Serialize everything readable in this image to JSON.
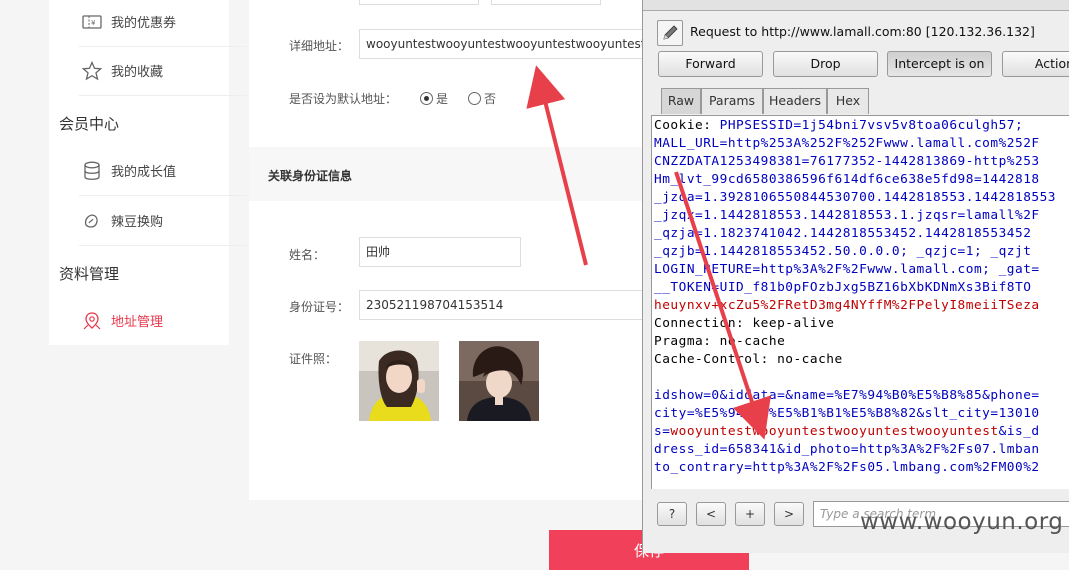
{
  "sidebar": {
    "items": [
      {
        "label": "我的优惠券",
        "icon": "coupon-icon"
      },
      {
        "label": "我的收藏",
        "icon": "star-icon"
      },
      {
        "label": "我的成长值",
        "icon": "database-icon"
      },
      {
        "label": "辣豆换购",
        "icon": "bean-icon"
      },
      {
        "label": "地址管理",
        "icon": "location-pin-icon"
      }
    ],
    "heads": [
      "会员中心",
      "资料管理"
    ]
  },
  "form": {
    "address_label": "详细地址：",
    "address_value": "wooyuntestwooyuntestwooyuntestwooyuntest",
    "default_label": "是否设为默认地址：",
    "yes": "是",
    "no": "否",
    "section_title": "关联身份证信息",
    "name_label": "姓名：",
    "name_value": "田帅",
    "id_label": "身份证号：",
    "id_value": "230521198704153514",
    "photo_label": "证件照：",
    "save": "保存"
  },
  "burp": {
    "request": "Request to http://www.lamall.com:80  [120.132.36.132]",
    "buttons": [
      "Forward",
      "Drop",
      "Intercept is on",
      "Action"
    ],
    "tabs": [
      "Raw",
      "Params",
      "Headers",
      "Hex"
    ],
    "lines": [
      {
        "k": "Cookie: ",
        "v": "PHPSESSID=1j54bni7vsv5v8toa06culgh57;"
      },
      {
        "k": "",
        "v": "MALL_URL=http%253A%252F%252Fwww.lamall.com%252F"
      },
      {
        "k": "",
        "v": "CNZZDATA1253498381=76177352-1442813869-http%253"
      },
      {
        "k": "",
        "v": "Hm_lvt_99cd6580386596f614df6ce638e5fd98=1442818"
      },
      {
        "k": "",
        "v": "_jzqa=1.3928106550844530700.1442818553.1442818553"
      },
      {
        "k": "",
        "v": "_jzqx=1.1442818553.1442818553.1.jzqsr=lamall%2F"
      },
      {
        "k": "",
        "v": "_qzja=1.1823741042.1442818553452.1442818553452"
      },
      {
        "k": "",
        "v": "_qzjb=1.1442818553452.50.0.0.0; _qzjc=1; _qzjt"
      },
      {
        "k": "",
        "v": "LOGIN_RETURE=http%3A%2F%2Fwww.lamall.com; _gat="
      },
      {
        "k": "",
        "v": "__TOKEN=UID_f81b0pFOzbJxg5BZ16bXbKDNmXs3Bif8TO"
      },
      {
        "k": "",
        "v": "heuynxv+xcZu5%2FRetD3mg4NYffM%2FPelyI8meiiTSeza"
      },
      {
        "k": "Connection: keep-alive",
        "v": ""
      },
      {
        "k": "Pragma: no-cache",
        "v": ""
      },
      {
        "k": "Cache-Control: no-cache",
        "v": ""
      },
      {
        "k": "",
        "v": ""
      },
      {
        "k": "",
        "v": "idshow=0&iddata=&name=%E7%94%B0%E5%B8%85&phone="
      },
      {
        "k": "",
        "v": "city=%E5%94%B0%E5%B1%B1%E5%B8%82&slt_city=13010"
      },
      {
        "k": "",
        "v": "s=wooyuntestwooyuntestwooyuntestwooyuntest&is_d"
      },
      {
        "k": "",
        "v": "dress_id=658341&id_photo=http%3A%2F%2Fs07.lmban"
      },
      {
        "k": "",
        "v": "to_contrary=http%3A%2F%2Fs05.lmbang.com%2FM00%2"
      }
    ],
    "search_placeholder": "Type a search term",
    "search_buttons": [
      "?",
      "<",
      "+",
      ">"
    ]
  },
  "watermark": "www.wooyun.org",
  "colors": {
    "accent": "#e8374a",
    "save": "#f0405a",
    "arrow": "#e8404a"
  }
}
